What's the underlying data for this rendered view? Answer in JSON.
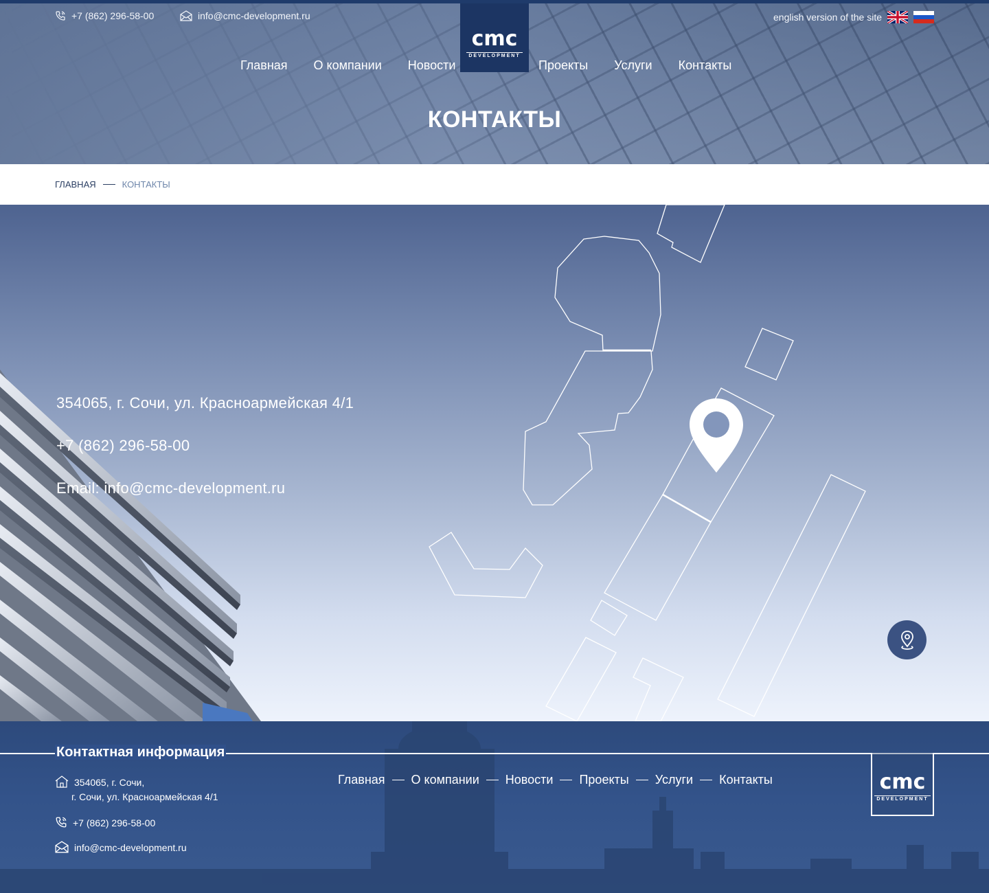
{
  "topbar": {
    "phone": "+7 (862) 296-58-00",
    "email": "info@cmc-development.ru",
    "lang_label": "english version of the site",
    "flags": [
      "uk-flag-icon",
      "russia-flag-icon"
    ]
  },
  "logo": {
    "main": "cmc",
    "sub": "DEVELOPMENT"
  },
  "nav": {
    "left": [
      "Главная",
      "О компании",
      "Новости"
    ],
    "right": [
      "Проекты",
      "Услуги",
      "Контакты"
    ]
  },
  "page_title": "КОНТАКТЫ",
  "breadcrumb": {
    "home": "ГЛАВНАЯ",
    "current": "КОНТАКТЫ"
  },
  "contact": {
    "address": "354065, г. Сочи, ул. Красноармейская 4/1",
    "phone": "+7 (862) 296-58-00",
    "email": "Email: info@cmc-development.ru"
  },
  "footer": {
    "heading": "Контактная информация",
    "address_line1": "354065, г. Сочи,",
    "address_line2": "г. Сочи, ул. Красноармейская 4/1",
    "phone": "+7 (862) 296-58-00",
    "email": "info@cmc-development.ru",
    "nav": [
      "Главная",
      "О компании",
      "Новости",
      "Проекты",
      "Услуги",
      "Контакты"
    ]
  },
  "colors": {
    "brand_navy": "#1c3563",
    "footer_blue": "#33538a",
    "pin_button": "#3b5282",
    "breadcrumb_current": "#6e86aa"
  }
}
